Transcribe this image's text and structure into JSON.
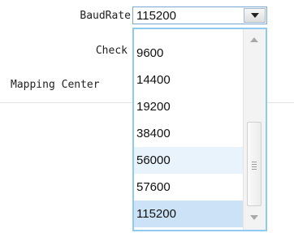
{
  "form": {
    "baudrate_label": "BaudRate",
    "check_label": "Check",
    "mapping_label": "Mapping Center"
  },
  "baudrate_select": {
    "selected": "115200",
    "options": [
      "9600",
      "14400",
      "19200",
      "38400",
      "56000",
      "57600",
      "115200"
    ],
    "hovered_option": "56000",
    "highlighted_option": "115200"
  },
  "icons": {
    "dropdown_arrow": "chevron-down-icon",
    "scroll_up": "scroll-up-arrow-icon",
    "scroll_down": "scroll-down-arrow-icon",
    "thumb_grip": "scroll-grip-icon"
  },
  "colors": {
    "dropdown_border": "#8fcaf0",
    "hover_bg": "#e9f3fc",
    "selected_bg": "#cce3f7"
  }
}
